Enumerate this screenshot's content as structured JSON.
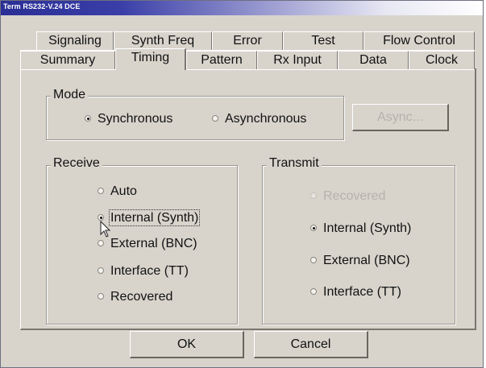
{
  "window": {
    "title": "Term RS232-V.24 DCE"
  },
  "tabs_back": [
    "Signaling",
    "Synth Freq",
    "Error",
    "Test",
    "Flow Control"
  ],
  "tabs_front": [
    "Summary",
    "Timing",
    "Pattern",
    "Rx Input",
    "Data",
    "Clock"
  ],
  "active_tab": "Timing",
  "mode": {
    "label": "Mode",
    "options": [
      "Synchronous",
      "Asynchronous"
    ],
    "selected": "Synchronous",
    "async_button": "Async..."
  },
  "receive": {
    "label": "Receive",
    "options": [
      "Auto",
      "Internal (Synth)",
      "External (BNC)",
      "Interface (TT)",
      "Recovered"
    ],
    "selected": "Internal (Synth)"
  },
  "transmit": {
    "label": "Transmit",
    "options": [
      "Recovered",
      "Internal (Synth)",
      "External (BNC)",
      "Interface (TT)"
    ],
    "selected": "Internal (Synth)",
    "disabled": [
      "Recovered"
    ]
  },
  "buttons": {
    "ok": "OK",
    "cancel": "Cancel"
  }
}
